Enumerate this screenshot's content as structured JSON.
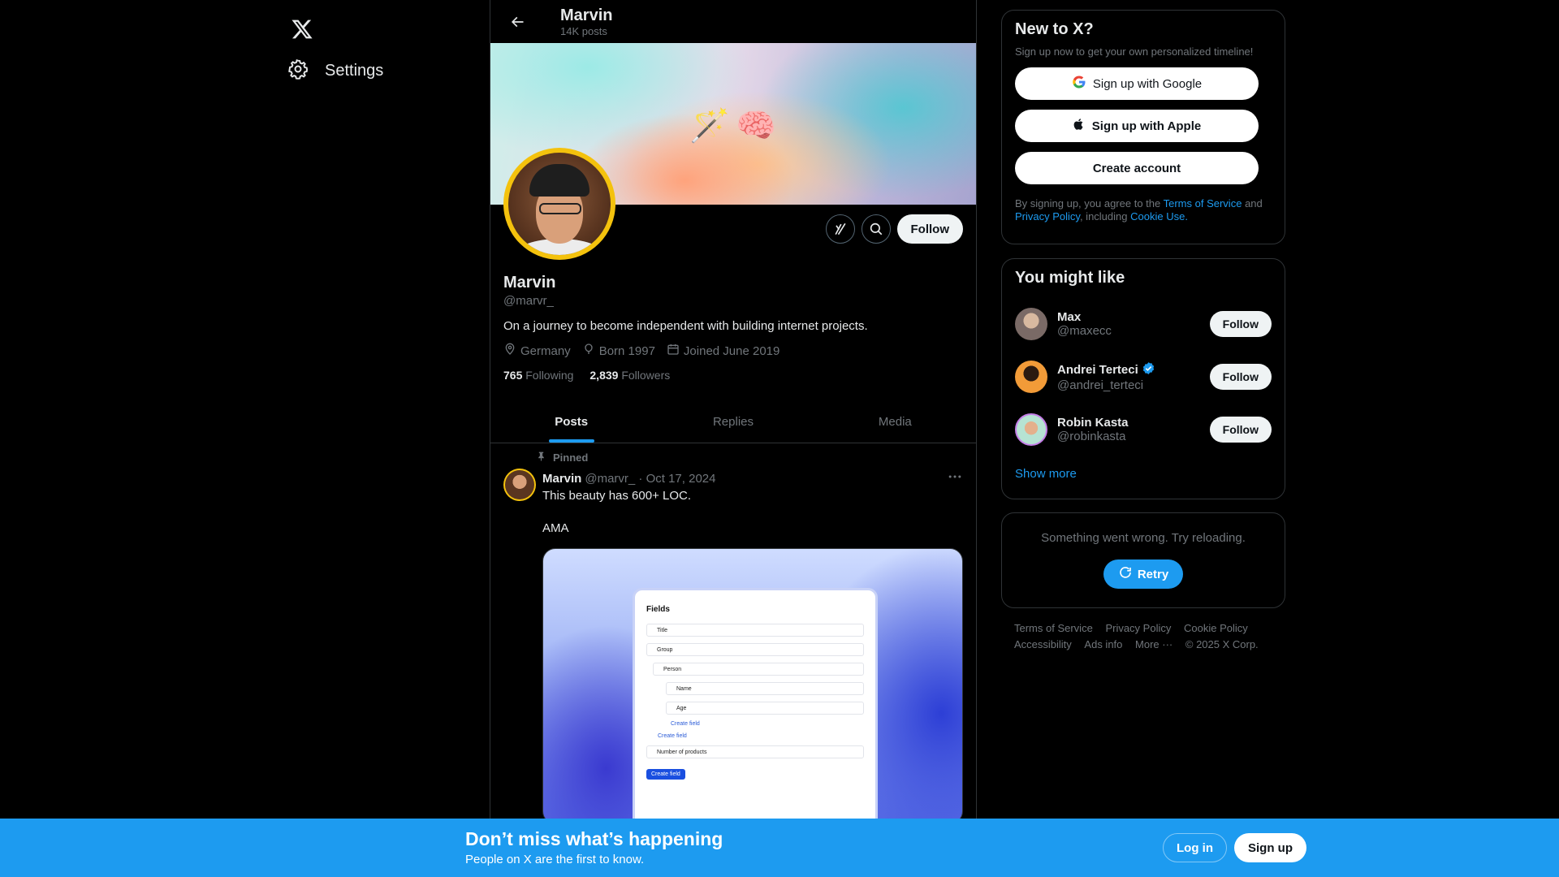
{
  "nav": {
    "logo_icon": "x-logo-icon",
    "settings_label": "Settings"
  },
  "header": {
    "name": "Marvin",
    "post_count": "14K posts"
  },
  "banner": {
    "emoji_left": "🪄",
    "emoji_right": "🧠"
  },
  "profile": {
    "name": "Marvin",
    "handle": "@marvr_",
    "bio": "On a journey to become independent with building internet projects.",
    "location": "Germany",
    "born": "Born 1997",
    "joined": "Joined June 2019",
    "following_count": "765",
    "following_label": "Following",
    "followers_count": "2,839",
    "followers_label": "Followers",
    "follow_label": "Follow"
  },
  "tabs": [
    {
      "label": "Posts",
      "active": true
    },
    {
      "label": "Replies",
      "active": false
    },
    {
      "label": "Media",
      "active": false
    }
  ],
  "post": {
    "pinned_label": "Pinned",
    "author": "Marvin",
    "handle_date": "@marvr_ · Oct 17, 2024",
    "line1": "This beauty has 600+ LOC.",
    "line2": "AMA",
    "media": {
      "title": "Fields",
      "fields": [
        "Title",
        "Group",
        "Person",
        "Name",
        "Age"
      ],
      "create_field": "Create field",
      "number_of_products": "Number of products"
    }
  },
  "signup_card": {
    "title": "New to X?",
    "subtitle": "Sign up now to get your own personalized timeline!",
    "google": "Sign up with Google",
    "apple": "Sign up with Apple",
    "create": "Create account",
    "legal_prefix": "By signing up, you agree to the",
    "terms": "Terms of Service",
    "and": "and",
    "privacy": "Privacy Policy",
    "including": ", including",
    "cookie": "Cookie Use."
  },
  "suggestions": {
    "title": "You might like",
    "follow_label": "Follow",
    "show_more": "Show more",
    "items": [
      {
        "name": "Max",
        "handle": "@maxecc",
        "verified": false
      },
      {
        "name": "Andrei Terteci",
        "handle": "@andrei_terteci",
        "verified": true
      },
      {
        "name": "Robin Kasta",
        "handle": "@robinkasta",
        "verified": false
      }
    ]
  },
  "error_card": {
    "message": "Something went wrong. Try reloading.",
    "retry": "Retry"
  },
  "footer": {
    "links": [
      "Terms of Service",
      "Privacy Policy",
      "Cookie Policy",
      "Accessibility",
      "Ads info",
      "More ···",
      "© 2025 X Corp."
    ]
  },
  "bottom_bar": {
    "title": "Don’t miss what’s happening",
    "subtitle": "People on X are the first to know.",
    "login": "Log in",
    "signup": "Sign up"
  },
  "colors": {
    "accent": "#1d9bf0",
    "background": "#000000",
    "avatar_ring": "#f4c20d"
  }
}
